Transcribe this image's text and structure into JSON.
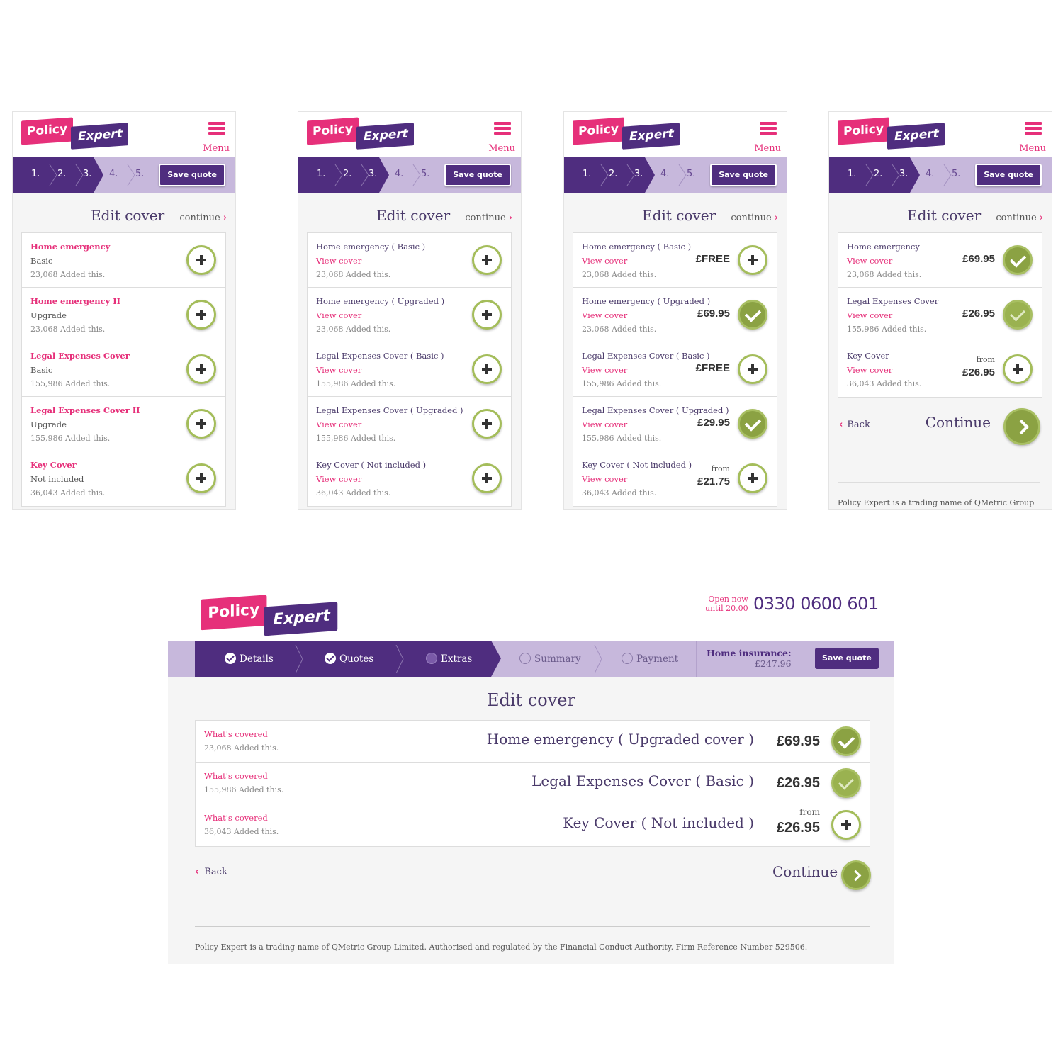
{
  "brand": {
    "logo_policy": "Policy",
    "logo_expert": "Expert",
    "pink": "#e6307a",
    "purple": "#4f2d7f",
    "green": "#8ba243",
    "lilac": "#c7b8dc"
  },
  "mobile": {
    "menu_label": "Menu",
    "steps": [
      "1.",
      "2.",
      "3.",
      "4.",
      "5."
    ],
    "save_quote": "Save quote",
    "title": "Edit cover",
    "continue_link": "continue",
    "screens": [
      {
        "items": [
          {
            "title": "Home emergency",
            "sub": "Basic",
            "added": "23,068 Added this.",
            "action": "add"
          },
          {
            "title": "Home emergency II",
            "sub": "Upgrade",
            "added": "23,068 Added this.",
            "action": "add"
          },
          {
            "title": "Legal Expenses Cover",
            "sub": "Basic",
            "added": "155,986 Added this.",
            "action": "add"
          },
          {
            "title": "Legal Expenses Cover II",
            "sub": "Upgrade",
            "added": "155,986 Added this.",
            "action": "add"
          },
          {
            "title": "Key Cover",
            "sub": "Not included",
            "added": "36,043 Added this.",
            "action": "add"
          }
        ]
      },
      {
        "items": [
          {
            "title": "Home emergency ( Basic )",
            "link": "View cover",
            "added": "23,068 Added this.",
            "action": "add"
          },
          {
            "title": "Home emergency ( Upgraded )",
            "link": "View cover",
            "added": "23,068 Added this.",
            "action": "add"
          },
          {
            "title": "Legal Expenses Cover ( Basic )",
            "link": "View cover",
            "added": "155,986 Added this.",
            "action": "add"
          },
          {
            "title": "Legal Expenses Cover ( Upgraded )",
            "link": "View cover",
            "added": "155,986 Added this.",
            "action": "add"
          },
          {
            "title": "Key Cover ( Not included )",
            "link": "View cover",
            "added": "36,043 Added this.",
            "action": "add"
          }
        ]
      },
      {
        "items": [
          {
            "title": "Home emergency ( Basic )",
            "link": "View cover",
            "added": "23,068 Added this.",
            "price": "£FREE",
            "action": "add"
          },
          {
            "title": "Home emergency ( Upgraded )",
            "link": "View cover",
            "added": "23,068 Added this.",
            "price": "£69.95",
            "action": "selected"
          },
          {
            "title": "Legal Expenses Cover ( Basic )",
            "link": "View cover",
            "added": "155,986 Added this.",
            "price": "£FREE",
            "action": "add"
          },
          {
            "title": "Legal Expenses Cover ( Upgraded )",
            "link": "View cover",
            "added": "155,986 Added this.",
            "price": "£29.95",
            "action": "selected"
          },
          {
            "title": "Key Cover ( Not included )",
            "link": "View cover",
            "added": "36,043 Added this.",
            "from": "from",
            "price": "£21.75",
            "action": "add"
          }
        ]
      },
      {
        "items": [
          {
            "title": "Home emergency",
            "link": "View cover",
            "added": "23,068 Added this.",
            "price": "£69.95",
            "action": "selected"
          },
          {
            "title": "Legal Expenses Cover",
            "link": "View cover",
            "added": "155,986 Added this.",
            "price": "£26.95",
            "action": "included"
          },
          {
            "title": "Key Cover",
            "link": "View cover",
            "added": "36,043 Added this.",
            "from": "from",
            "price": "£26.95",
            "action": "add"
          }
        ],
        "back": "Back",
        "continue": "Continue",
        "footer": "Policy Expert is a trading name of QMetric Group"
      }
    ]
  },
  "desktop": {
    "open_now": "Open now",
    "until": "until 20.00",
    "phone": "0330 0600 601",
    "steps": [
      {
        "label": "Details",
        "state": "done"
      },
      {
        "label": "Quotes",
        "state": "done"
      },
      {
        "label": "Extras",
        "state": "current"
      },
      {
        "label": "Summary",
        "state": "todo"
      },
      {
        "label": "Payment",
        "state": "todo"
      }
    ],
    "home_insurance_label": "Home insurance:",
    "home_insurance_price": "£247.96",
    "save_quote": "Save quote",
    "title": "Edit cover",
    "items": [
      {
        "whats": "What's covered",
        "added": "23,068 Added this.",
        "name": "Home emergency ( Upgraded cover )",
        "price": "£69.95",
        "action": "selected"
      },
      {
        "whats": "What's covered",
        "added": "155,986 Added this.",
        "name": "Legal Expenses Cover ( Basic )",
        "price": "£26.95",
        "action": "included"
      },
      {
        "whats": "What's covered",
        "added": "36,043 Added this.",
        "name": "Key Cover ( Not included )",
        "from": "from",
        "price": "£26.95",
        "action": "add"
      }
    ],
    "back": "Back",
    "continue": "Continue",
    "footer": "Policy Expert is a trading name of QMetric Group Limited. Authorised and regulated by the Financial Conduct Authority. Firm Reference Number 529506."
  }
}
